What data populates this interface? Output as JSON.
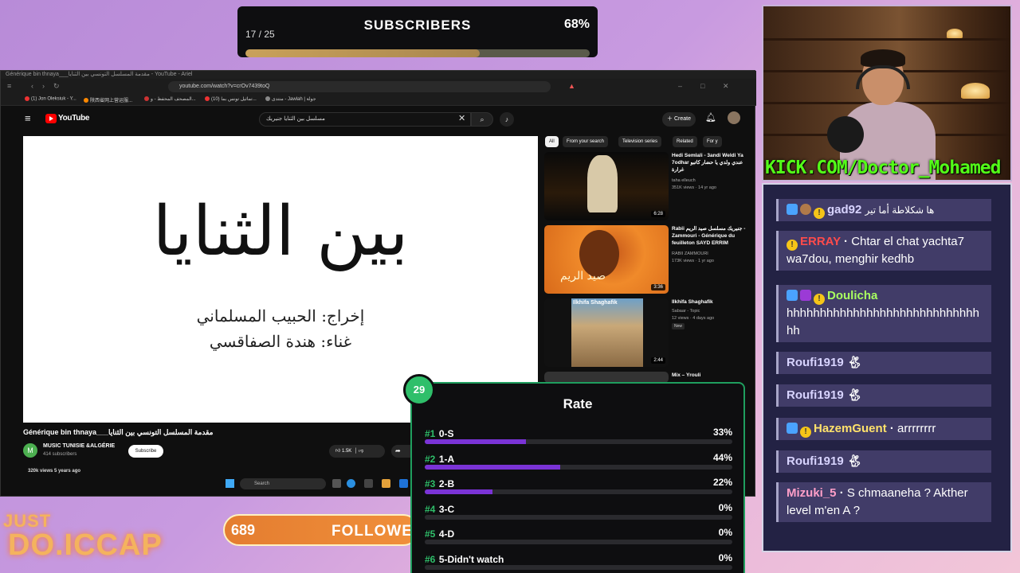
{
  "subscribers": {
    "title": "SUBSCRIBERS",
    "count": "17 / 25",
    "percent": "68%",
    "progress": 0.68
  },
  "browser": {
    "tab_title": "Générique bin thnaya___مقدمة المسلسل التونسي بين الثنايا - YouTube - Ariel",
    "url": "youtube.com/watch?v=crOv7439toQ",
    "bookmarks": [
      "(1) Jon Oleksiuk - Y...",
      "陕西省网上营运服...",
      "المصحف المحفظ - و...",
      "(10) تماثيل تونس بما...",
      "منتدى - Jawlah | جولة"
    ]
  },
  "youtube": {
    "logo_text": "YouTube",
    "search_value": "مسلسل بين الثنايا جنيريك",
    "create_label": "Create",
    "chips": [
      "All",
      "From your search",
      "Television series",
      "Related",
      "For y"
    ],
    "video_lines": [
      "بين الثنايا",
      "إخراج: الحبيب المسلماني",
      "غناء: هندة الصفاقسي"
    ],
    "video_title": "Générique bin thnaya___مقدمة المسلسل التونسي بين الثنايا",
    "channel_initial": "M",
    "channel_name": "MUSIC TUNISIE &ALGÉRIE",
    "channel_subs": "414 subscribers",
    "subscribe_label": "Subscribe",
    "likes": "1.5K",
    "views": "320k views  5 years ago",
    "taskbar_search": "Search",
    "related": [
      {
        "title": "Hedi Semlali - 3andi Weldi Ya 7odhar عندي ولدي يا حضار كاتبو غرارة",
        "channel": "taha elleuch",
        "meta": "351K views · 14 yr ago",
        "duration": "6:28",
        "badge": ""
      },
      {
        "title": "Rabii جنيريك مسلسل صيد الريم - Zammouri - Générique du feuilleton SAYD ERRIM",
        "channel": "RABII ZAMMOURI",
        "meta": "173K views · 1 yr ago",
        "duration": "3:36",
        "badge": ""
      },
      {
        "title": "Ilkhifa Shaghafik",
        "channel": "Sabaar - Topic",
        "meta": "12 views · 4 days ago",
        "duration": "2:44",
        "badge": "New"
      },
      {
        "title": "Mix – Yrouli",
        "channel": "",
        "meta": "",
        "duration": "",
        "badge": ""
      }
    ]
  },
  "stream": {
    "kick_url": "KICK.COM/Doctor_Mohamed",
    "follower_count": "689",
    "follower_label": "FOLLOWERS",
    "logo_line1": "JUST",
    "logo_line2": "DO.ICCAP"
  },
  "chat": [
    {
      "user": "gad92",
      "text": "ها شكلاطة أما تير",
      "color": "#d8d4ff"
    },
    {
      "user": "ERRAY",
      "text": "Chtar el chat yachta7 wa7dou, menghir kedhb",
      "color": "#ff4b4b"
    },
    {
      "user": "Doulicha",
      "text": "hhhhhhhhhhhhhhhhhhhhhhhhhhhhhhh",
      "color": "#a8ff60"
    },
    {
      "user": "Roufi1919",
      "text": "",
      "color": "#d8d4ff"
    },
    {
      "user": "Roufi1919",
      "text": "",
      "color": "#d8d4ff"
    },
    {
      "user": "HazemGuent",
      "text": "arrrrrrrr",
      "color": "#ffe26b"
    },
    {
      "user": "Roufi1919",
      "text": "",
      "color": "#d8d4ff"
    },
    {
      "user": "Mizuki_5",
      "text": "S chmaaneha ? Akther level m'en A ?",
      "color": "#ff9fc8"
    }
  ],
  "poll": {
    "title": "Rate",
    "timer": "29",
    "options": [
      {
        "num": "#1",
        "label": "0-S",
        "percent": "33%",
        "value": 33
      },
      {
        "num": "#2",
        "label": "1-A",
        "percent": "44%",
        "value": 44
      },
      {
        "num": "#3",
        "label": "2-B",
        "percent": "22%",
        "value": 22
      },
      {
        "num": "#4",
        "label": "3-C",
        "percent": "0%",
        "value": 0
      },
      {
        "num": "#5",
        "label": "4-D",
        "percent": "0%",
        "value": 0
      },
      {
        "num": "#6",
        "label": "5-Didn't watch",
        "percent": "0%",
        "value": 0
      }
    ]
  }
}
